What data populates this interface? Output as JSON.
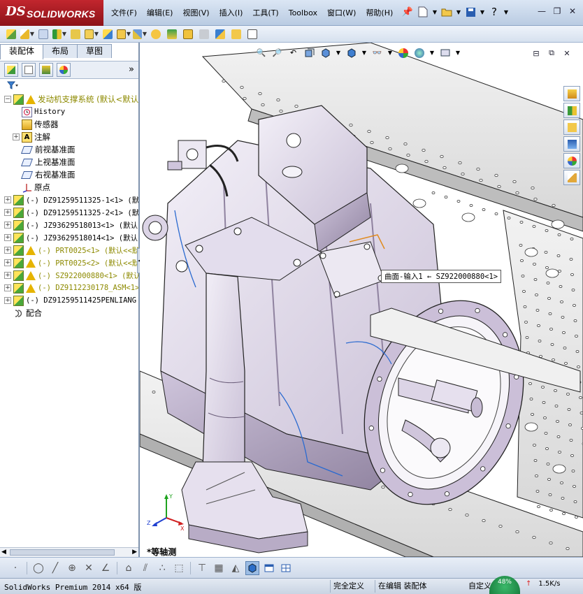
{
  "app": {
    "logo_ds": "DS",
    "logo_text": "SOLIDWORKS",
    "menus": [
      "文件(F)",
      "编辑(E)",
      "视图(V)",
      "插入(I)",
      "工具(T)",
      "Toolbox",
      "窗口(W)",
      "帮助(H)"
    ]
  },
  "left_panel": {
    "tabs": [
      "装配体",
      "布局",
      "草图"
    ],
    "more": "»",
    "tree": [
      {
        "label": "发动机支撑系统  (默认<默认",
        "icon": "assembly",
        "warn": true,
        "olive": true,
        "expander": "-",
        "indent": 0
      },
      {
        "label": "History",
        "icon": "history",
        "indent": 1,
        "mono": true
      },
      {
        "label": "传感器",
        "icon": "sensor",
        "indent": 1
      },
      {
        "label": "注解",
        "icon": "annotation",
        "indent": 1,
        "expander": "+"
      },
      {
        "label": "前视基准面",
        "icon": "plane",
        "indent": 1
      },
      {
        "label": "上视基准面",
        "icon": "plane",
        "indent": 1
      },
      {
        "label": "右视基准面",
        "icon": "plane",
        "indent": 1
      },
      {
        "label": "原点",
        "icon": "origin",
        "indent": 1
      },
      {
        "label": "(-) DZ91259511325-1<1> (默",
        "icon": "part",
        "expander": "+",
        "indent": 0,
        "mono": true
      },
      {
        "label": "(-) DZ91259511325-2<1> (默",
        "icon": "part",
        "expander": "+",
        "indent": 0,
        "mono": true
      },
      {
        "label": "(-) JZ93629518013<1> (默认",
        "icon": "part",
        "expander": "+",
        "indent": 0,
        "mono": true
      },
      {
        "label": "(-) JZ93629518014<1> (默认",
        "icon": "part",
        "expander": "+",
        "indent": 0,
        "mono": true
      },
      {
        "label": "(-) PRT0025<1> (默认<<默",
        "icon": "part",
        "warn": true,
        "olive": true,
        "expander": "+",
        "indent": 0,
        "mono": true
      },
      {
        "label": "(-) PRT0025<2> (默认<<默",
        "icon": "part",
        "warn": true,
        "olive": true,
        "expander": "+",
        "indent": 0,
        "mono": true
      },
      {
        "label": "(-) SZ922000880<1> (默认",
        "icon": "part",
        "warn": true,
        "olive": true,
        "expander": "+",
        "indent": 0,
        "mono": true
      },
      {
        "label": "(-) DZ9112230178_ASM<1>",
        "icon": "assembly",
        "warn": true,
        "olive": true,
        "expander": "+",
        "indent": 0,
        "mono": true
      },
      {
        "label": "(-) DZ91259511425PENLIANG",
        "icon": "assembly",
        "expander": "+",
        "indent": 0,
        "mono": true
      },
      {
        "label": "配合",
        "icon": "mate",
        "indent": 0
      }
    ]
  },
  "viewport": {
    "tooltip": "曲面-输入1 ← SZ922000880<1>",
    "view_name": "*等轴测",
    "triad": {
      "x": "X",
      "y": "Y",
      "z": "Z"
    }
  },
  "status": {
    "app_version": "SolidWorks Premium 2014 x64 版",
    "definition": "完全定义",
    "editing": "在编辑 装配体",
    "custom": "自定义",
    "net_percent": "48%",
    "upload": "1.5K/s"
  },
  "colors": {
    "logo_red": "#b01c24",
    "part_body": "#ece8f2",
    "part_shadow": "#b8acc6",
    "frame_grey": "#e6e6e6",
    "edge_blue": "#2a6ad0"
  }
}
